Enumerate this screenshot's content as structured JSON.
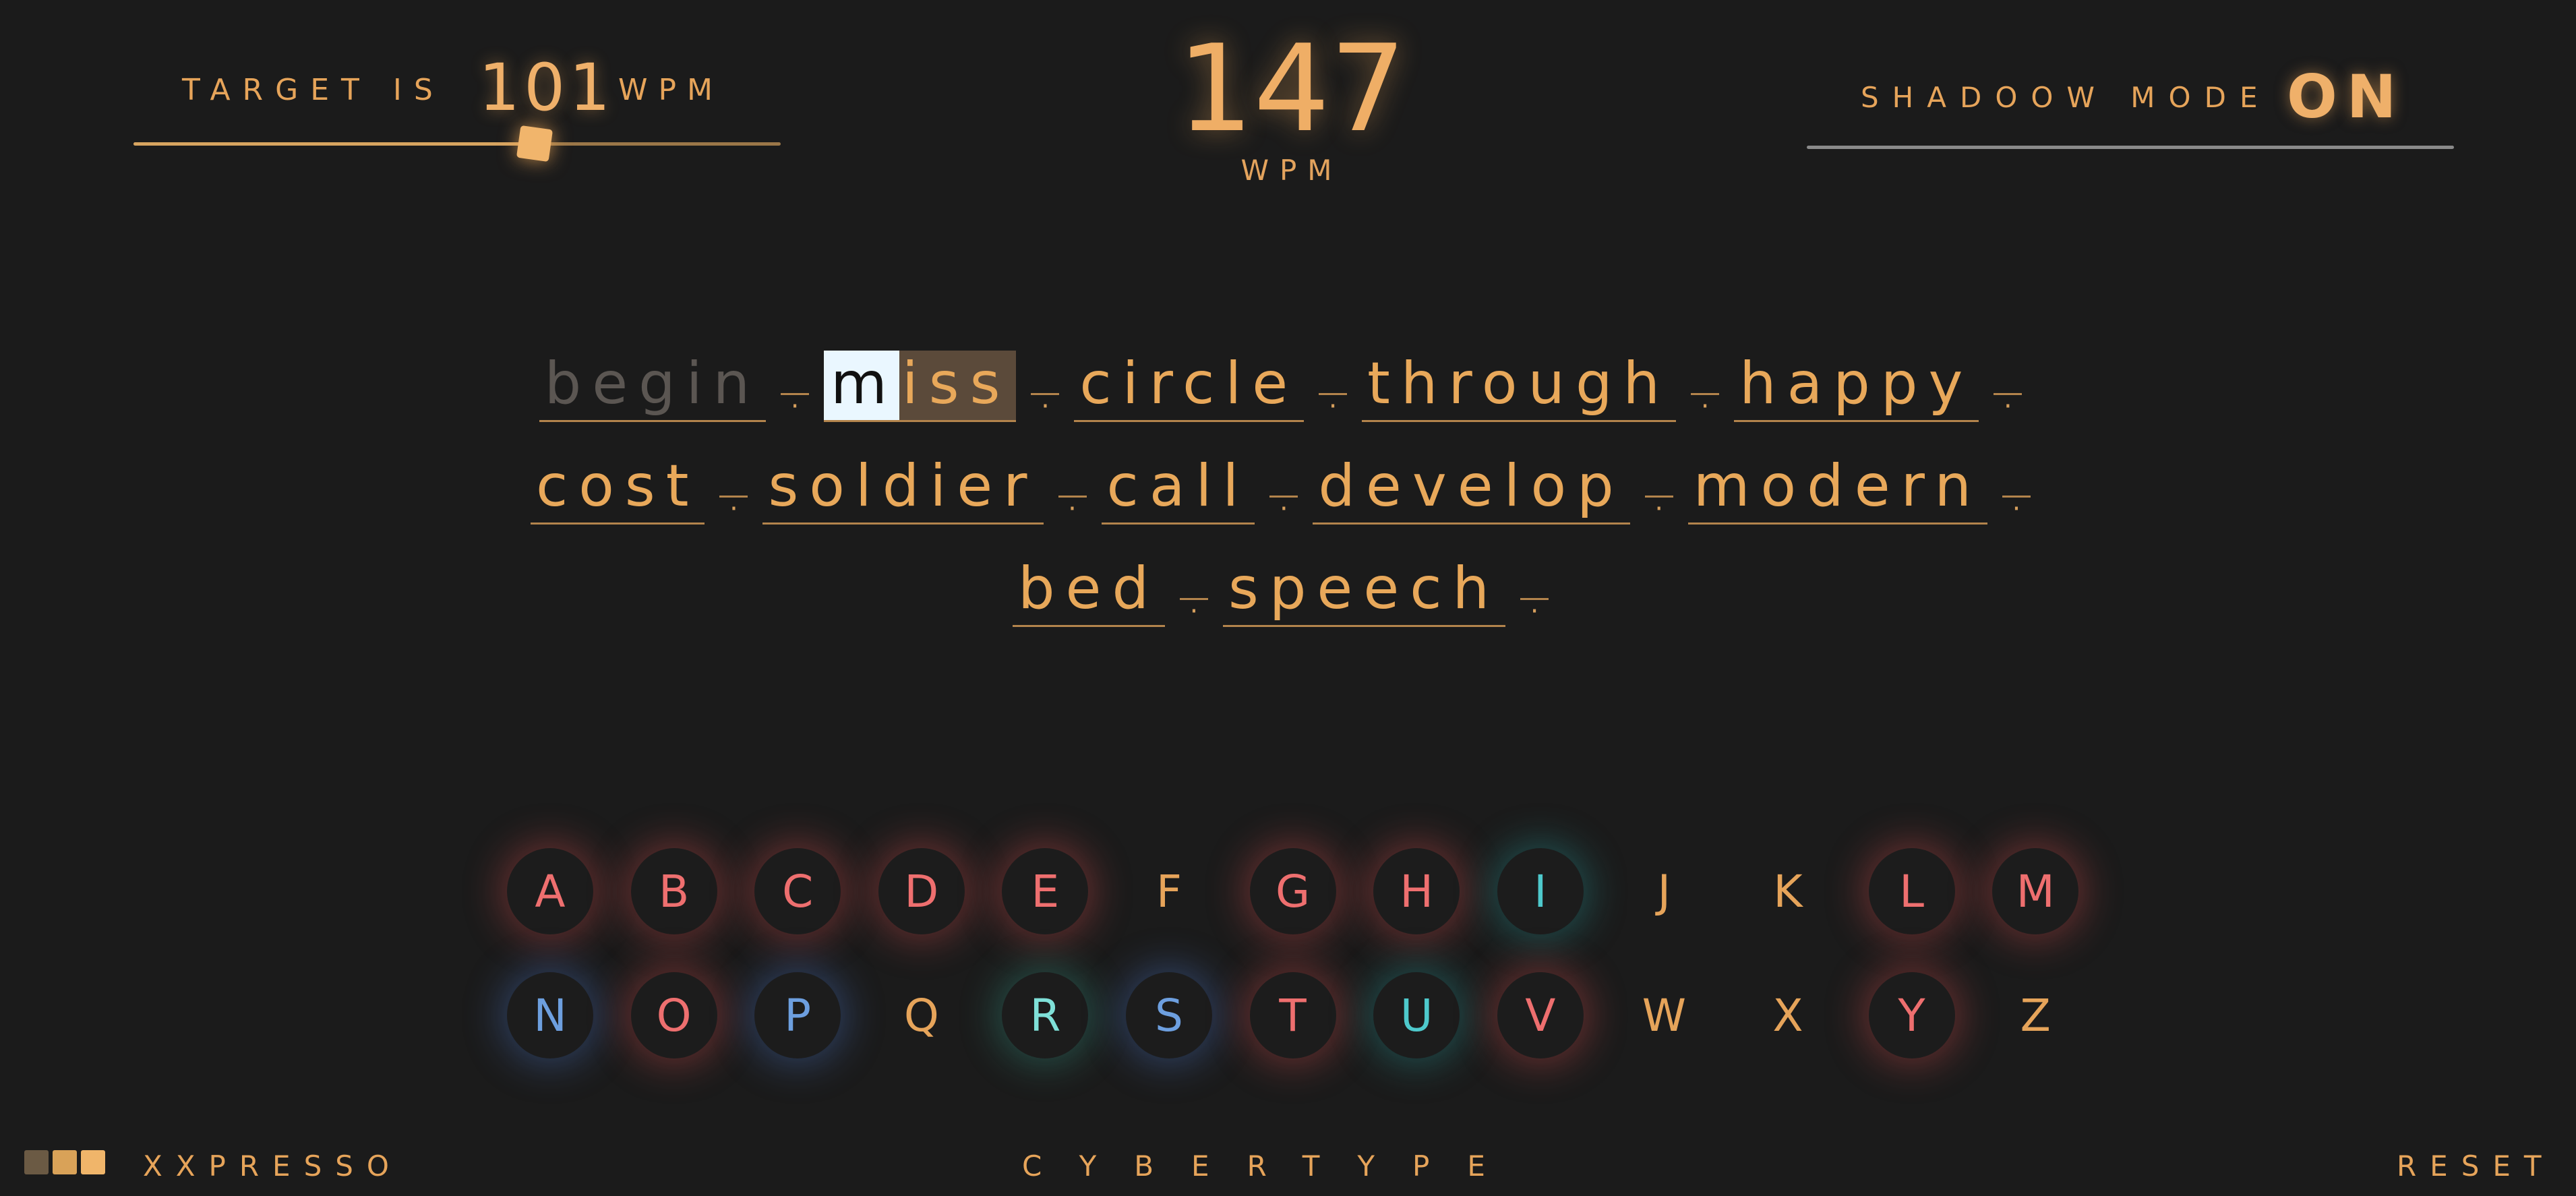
{
  "target": {
    "label": "TARGET IS",
    "value": "101",
    "unit": "WPM",
    "slider_fraction": 0.62
  },
  "wpm": {
    "value": "147",
    "unit": "WPM"
  },
  "shadow_mode": {
    "label": "SHADOOW MODE",
    "value": "ON"
  },
  "words": {
    "line1": [
      "begin",
      "miss",
      "circle",
      "through",
      "happy"
    ],
    "line2": [
      "cost",
      "soldier",
      "call",
      "develop",
      "modern"
    ],
    "line3": [
      "bed",
      "speech"
    ],
    "separator": "·",
    "current_first_letter": "m",
    "current_rest": "iss"
  },
  "keyboard": {
    "row1": [
      {
        "letter": "A",
        "tone": "red"
      },
      {
        "letter": "B",
        "tone": "red"
      },
      {
        "letter": "C",
        "tone": "red"
      },
      {
        "letter": "D",
        "tone": "red"
      },
      {
        "letter": "E",
        "tone": "red"
      },
      {
        "letter": "F",
        "tone": "plain"
      },
      {
        "letter": "G",
        "tone": "red"
      },
      {
        "letter": "H",
        "tone": "red"
      },
      {
        "letter": "I",
        "tone": "teal"
      },
      {
        "letter": "J",
        "tone": "plain"
      },
      {
        "letter": "K",
        "tone": "plain"
      },
      {
        "letter": "L",
        "tone": "red"
      },
      {
        "letter": "M",
        "tone": "red"
      }
    ],
    "row2": [
      {
        "letter": "N",
        "tone": "blue"
      },
      {
        "letter": "O",
        "tone": "red"
      },
      {
        "letter": "P",
        "tone": "blue"
      },
      {
        "letter": "Q",
        "tone": "plain"
      },
      {
        "letter": "R",
        "tone": "mint"
      },
      {
        "letter": "S",
        "tone": "blue"
      },
      {
        "letter": "T",
        "tone": "red"
      },
      {
        "letter": "U",
        "tone": "teal"
      },
      {
        "letter": "V",
        "tone": "red"
      },
      {
        "letter": "W",
        "tone": "plain"
      },
      {
        "letter": "X",
        "tone": "plain"
      },
      {
        "letter": "Y",
        "tone": "red"
      },
      {
        "letter": "Z",
        "tone": "plain"
      }
    ]
  },
  "footer": {
    "brand": "XXPRESSO",
    "title": "CYBERTYPE",
    "reset": "RESET",
    "block_colors": [
      "#6b5a44",
      "#d9a258",
      "#f0b56a"
    ]
  },
  "colors": {
    "background": "#1b1b1b",
    "accent": "#e8a85a",
    "red": "#ee6f6f",
    "blue": "#6d9fdf",
    "teal": "#4ec9cc"
  }
}
